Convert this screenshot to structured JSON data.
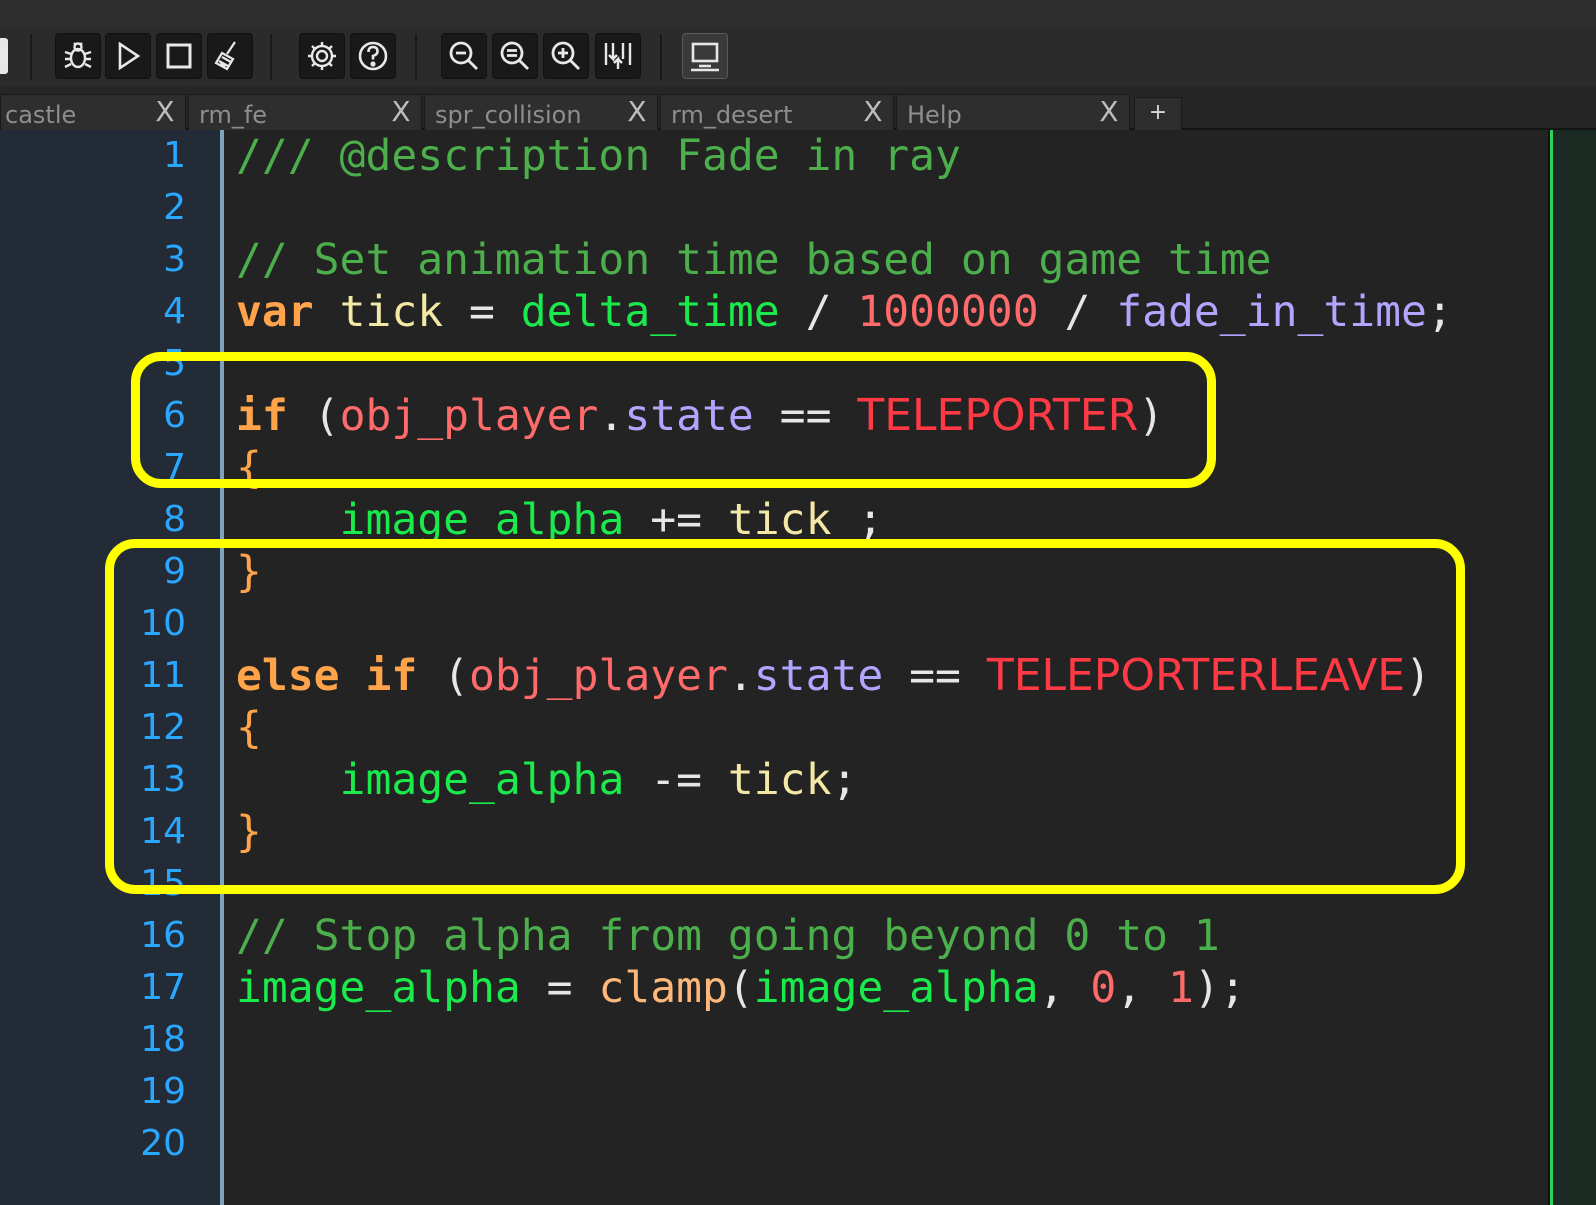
{
  "toolbar": {
    "buttons": [
      {
        "name": "debug",
        "icon": "bug-icon"
      },
      {
        "name": "run",
        "icon": "play-icon"
      },
      {
        "name": "stop",
        "icon": "stop-icon"
      },
      {
        "name": "clean",
        "icon": "broom-icon"
      },
      {
        "name": "preferences",
        "icon": "gear-icon"
      },
      {
        "name": "help",
        "icon": "question-icon"
      },
      {
        "name": "zoom-out",
        "icon": "zoom-out-icon"
      },
      {
        "name": "zoom-reset",
        "icon": "zoom-reset-icon"
      },
      {
        "name": "zoom-in",
        "icon": "zoom-in-icon"
      },
      {
        "name": "collapse-expand",
        "icon": "collapse-icon"
      },
      {
        "name": "fullscreen",
        "icon": "monitor-icon"
      }
    ]
  },
  "tabs": [
    {
      "label": "castle",
      "close": "X"
    },
    {
      "label": "rm_fe",
      "close": "X"
    },
    {
      "label": "spr_collision",
      "close": "X"
    },
    {
      "label": "rm_desert",
      "close": "X"
    },
    {
      "label": "Help",
      "close": "X"
    }
  ],
  "tab_add_label": "+",
  "line_numbers": [
    "1",
    "2",
    "3",
    "4",
    "5",
    "6",
    "7",
    "8",
    "9",
    "10",
    "11",
    "12",
    "13",
    "14",
    "15",
    "16",
    "17",
    "18",
    "19",
    "20"
  ],
  "code": {
    "l1": "/// @description Fade in ray",
    "l3": "// Set animation time based on game time",
    "l4": {
      "kw": "var",
      "v1": "tick",
      "eq": " = ",
      "b1": "delta_time",
      "d1": " / ",
      "n1": "1000000",
      "d2": " / ",
      "p1": "fade_in_time",
      "end": ";"
    },
    "l6": {
      "kw": "if",
      "open": " (",
      "obj": "obj_player",
      "dot": ".",
      "prop": "state",
      "eq": " == ",
      "const": "TELEPORTER",
      "close": ")"
    },
    "l7": "{",
    "l8": {
      "indent": "    ",
      "b1": "image_alpha",
      "op": " += ",
      "v1": "tick",
      "end": " ;"
    },
    "l9": "}",
    "l11": {
      "kw1": "else",
      "sp": " ",
      "kw2": "if",
      "open": " (",
      "obj": "obj_player",
      "dot": ".",
      "prop": "state",
      "eq": " == ",
      "const": "TELEPORTERLEAVE",
      "close": ")"
    },
    "l12": "{",
    "l13": {
      "indent": "    ",
      "b1": "image_alpha",
      "op": " -= ",
      "v1": "tick",
      "end": ";"
    },
    "l14": "}",
    "l16": "// Stop alpha from going beyond 0 to 1",
    "l17": {
      "b1": "image_alpha",
      "eq": " = ",
      "fn": "clamp",
      "open": "(",
      "b2": "image_alpha",
      "c1": ", ",
      "n1": "0",
      "c2": ", ",
      "n2": "1",
      "end": ");"
    }
  },
  "colors": {
    "highlight_box": "#ffff00",
    "line_number": "#2aa7ff",
    "comment": "#4caf4c",
    "keyword": "#ffa44a",
    "builtin": "#1bea4d",
    "constant": "#ff3a45"
  }
}
